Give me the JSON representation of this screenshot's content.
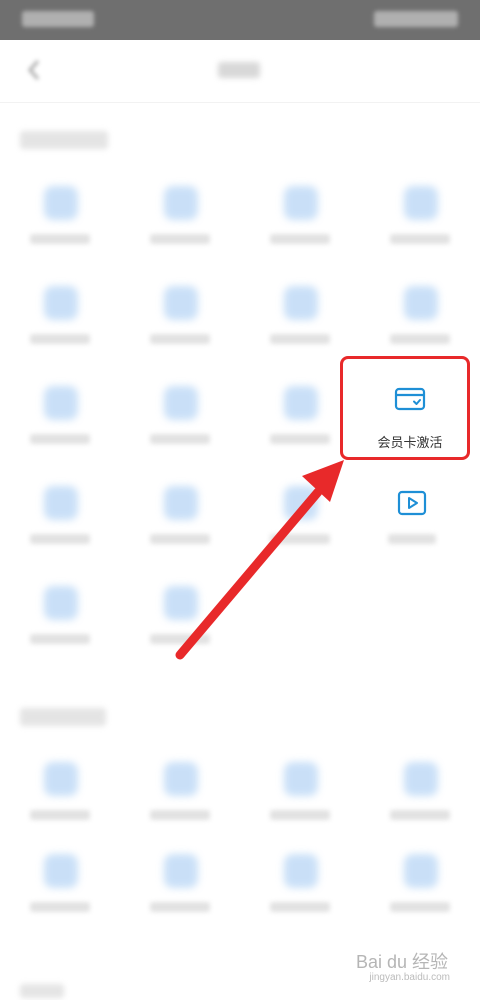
{
  "highlighted_item": {
    "label": "会员卡激活",
    "icon": "card-check-icon"
  },
  "second_item": {
    "label": "",
    "icon": "play-video-icon"
  },
  "watermark": {
    "brand": "Bai du 经验",
    "url": "jingyan.baidu.com"
  },
  "colors": {
    "accent": "#1e8fd6",
    "highlight": "#e8292a",
    "statusbar": "#6f6f6f"
  }
}
